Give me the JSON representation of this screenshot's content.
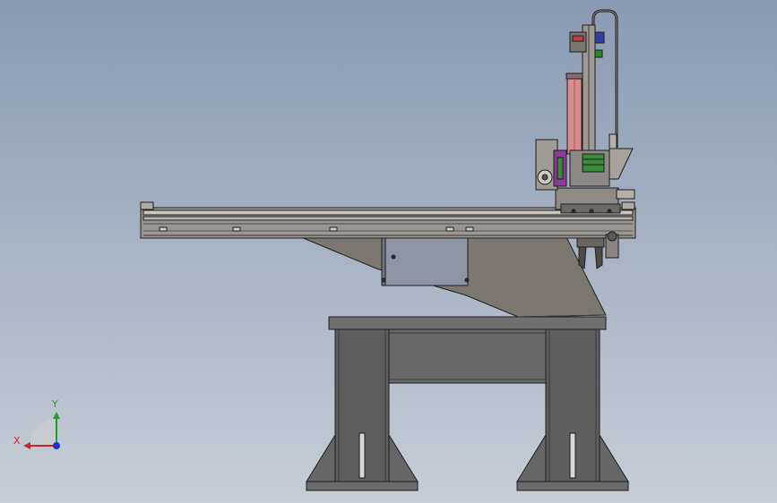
{
  "viewport": {
    "background_top": "#8a9ab2",
    "background_bottom": "#c6cdd6"
  },
  "model": {
    "parts": [
      "base-stand",
      "support-bracket",
      "horizontal-beam",
      "control-box",
      "carriage",
      "vertical-axis",
      "gripper"
    ],
    "colors": {
      "stand": "#5e5e5e",
      "bracket": "#7d7771",
      "beam": "#9a9590",
      "control_box": "#8d95a3",
      "cylinder": "#d98c8c",
      "accent_green": "#3a8a3a",
      "accent_purple": "#8a3a9a",
      "outline": "#1e1e1e"
    }
  },
  "triad": {
    "x_label": "X",
    "y_label": "Y",
    "x_color": "#d42020",
    "y_color": "#20a020",
    "z_color": "#2030d0"
  }
}
